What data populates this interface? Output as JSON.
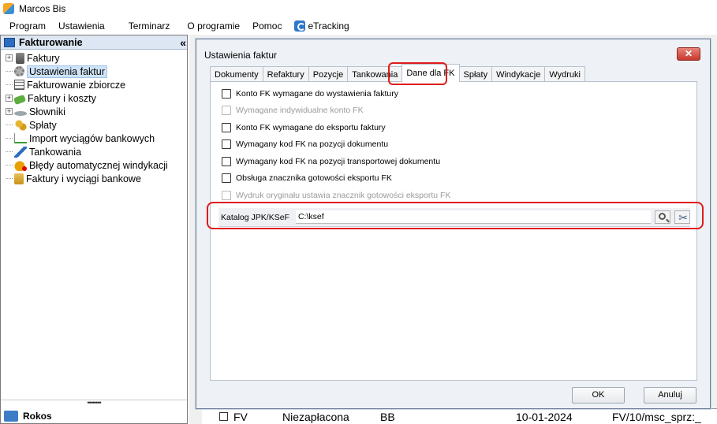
{
  "app": {
    "title": "Marcos Bis"
  },
  "menu": [
    "Program",
    "Ustawienia",
    "Terminarz",
    "O programie",
    "Pomoc",
    "eTracking"
  ],
  "left_panel": {
    "header": "Fakturowanie",
    "collapse_glyph": "«",
    "tree": [
      {
        "label": "Faktury",
        "icon": "faktury-icon",
        "expandable": true
      },
      {
        "label": "Ustawienia faktur",
        "icon": "gear-icon",
        "expandable": false,
        "selected": true
      },
      {
        "label": "Fakturowanie zbiorcze",
        "icon": "grid-icon",
        "expandable": false
      },
      {
        "label": "Faktury i koszty",
        "icon": "money-icon",
        "expandable": true
      },
      {
        "label": "Słowniki",
        "icon": "dictionary-icon",
        "expandable": true
      },
      {
        "label": "Spłaty",
        "icon": "coins-icon",
        "expandable": false
      },
      {
        "label": "Import wyciągów bankowych",
        "icon": "import-icon",
        "expandable": false
      },
      {
        "label": "Tankowania",
        "icon": "fuel-icon",
        "expandable": false
      },
      {
        "label": "Błędy automatycznej windykacji",
        "icon": "error-icon",
        "expandable": false
      },
      {
        "label": "Faktury i wyciągi bankowe",
        "icon": "bank-statements-icon",
        "expandable": false
      }
    ],
    "splitter": "••••••••",
    "bottom_item": "Rokos"
  },
  "background_row": {
    "type": "FV",
    "status": "Niezapłacona",
    "code": "BB",
    "date": "10-01-2024",
    "number": "FV/10/msc_sprz:_"
  },
  "dialog": {
    "title": "Ustawienia faktur",
    "close_glyph": "✕",
    "tabs": [
      "Dokumenty",
      "Refaktury",
      "Pozycje",
      "Tankowania",
      "Dane dla FK",
      "Spłaty",
      "Windykacje",
      "Wydruki"
    ],
    "active_tab": "Dane dla FK",
    "options": [
      {
        "label": "Konto FK wymagane do wystawienia faktury",
        "enabled": true,
        "checked": false
      },
      {
        "label": "Wymagane indywidualne konto FK",
        "enabled": false,
        "checked": false
      },
      {
        "label": "Konto FK wymagane do eksportu faktury",
        "enabled": true,
        "checked": false
      },
      {
        "label": "Wymagany kod FK na pozycji dokumentu",
        "enabled": true,
        "checked": false
      },
      {
        "label": "Wymagany kod FK na pozycji transportowej dokumentu",
        "enabled": true,
        "checked": false
      },
      {
        "label": "Obsługa znacznika gotowości eksportu FK",
        "enabled": true,
        "checked": false
      },
      {
        "label": "Wydruk oryginału ustawia znacznik gotowości eksportu FK",
        "enabled": false,
        "checked": false
      }
    ],
    "katalog": {
      "label": "Katalog JPK/KSeF",
      "value": "C:\\ksef"
    },
    "ok_label": "OK",
    "cancel_label": "Anuluj"
  },
  "colors": {
    "highlight": "#e01b1b",
    "close_button": "#c7392c",
    "selection": "#cfe3f7"
  }
}
